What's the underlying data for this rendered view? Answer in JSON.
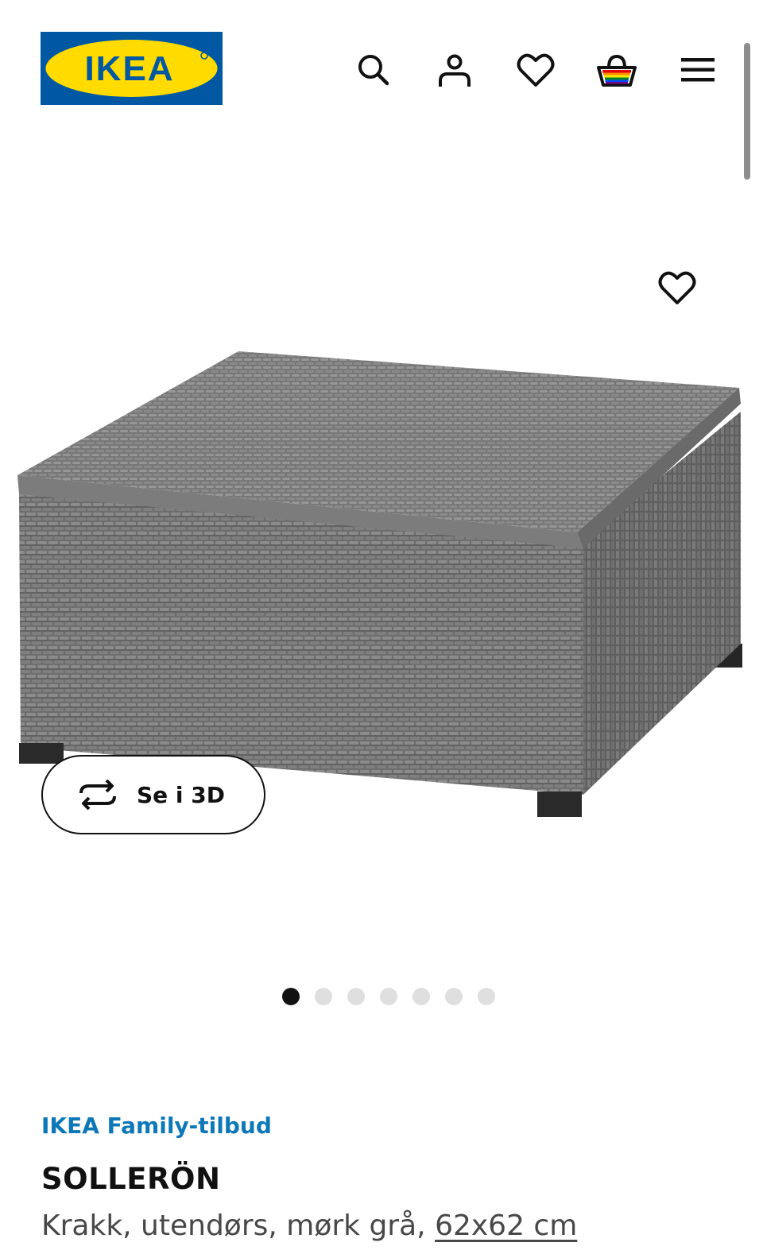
{
  "header": {
    "logo_text": "IKEA",
    "icons": [
      "search-icon",
      "user-icon",
      "heart-icon",
      "basket-icon",
      "menu-icon"
    ]
  },
  "gallery": {
    "view_3d_label": "Se i 3D",
    "image_count": 7,
    "active_index": 1
  },
  "product": {
    "promo": "IKEA Family-tilbud",
    "name": "SOLLERÖN",
    "description": "Krakk, utendørs, mørk grå, ",
    "size": "62x62 cm"
  },
  "colors": {
    "promo_blue": "#0c78b8",
    "logo_blue": "#0058a3",
    "logo_yellow": "#ffdb00"
  }
}
